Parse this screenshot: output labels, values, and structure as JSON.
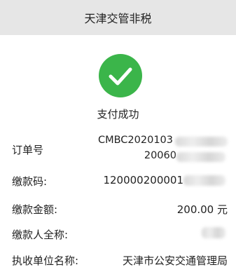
{
  "header": {
    "title": "天津交管非税"
  },
  "status": {
    "icon": "check-circle-icon",
    "text": "支付成功",
    "color": "#3bb54a"
  },
  "details": [
    {
      "label": "订单号",
      "value_line1": "CMBC2020103",
      "value_line2": "20060"
    },
    {
      "label": "缴款码:",
      "value": "120000200001"
    },
    {
      "label": "缴款金额:",
      "value": "200.00 元"
    },
    {
      "label": "缴款人全称:",
      "value": ""
    },
    {
      "label": "执收单位名称:",
      "value": "天津市公安交通管理局"
    }
  ]
}
